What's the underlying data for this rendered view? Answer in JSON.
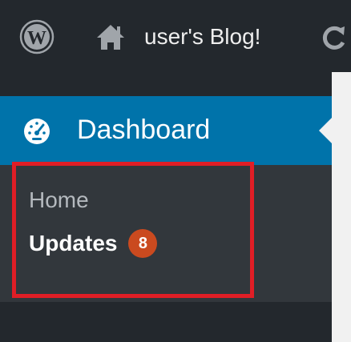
{
  "admin_bar": {
    "logo_icon": "wordpress-logo-icon",
    "home_icon": "home-icon",
    "site_name": "user's Blog!",
    "refresh_icon": "refresh-icon"
  },
  "admin_menu": {
    "dashboard": {
      "icon": "dashboard-gauge-icon",
      "label": "Dashboard"
    },
    "submenu": [
      {
        "label": "Home",
        "current": false
      },
      {
        "label": "Updates",
        "current": true,
        "badge": "8"
      }
    ]
  },
  "annotation": {
    "highlight_color": "#e01e26",
    "highlight_target": "Updates"
  },
  "colors": {
    "admin_bar_bg": "#23282d",
    "menu_bg": "#23282d",
    "active_bg": "#0073aa",
    "submenu_bg": "#32373c",
    "badge_bg": "#ca4a1f"
  }
}
